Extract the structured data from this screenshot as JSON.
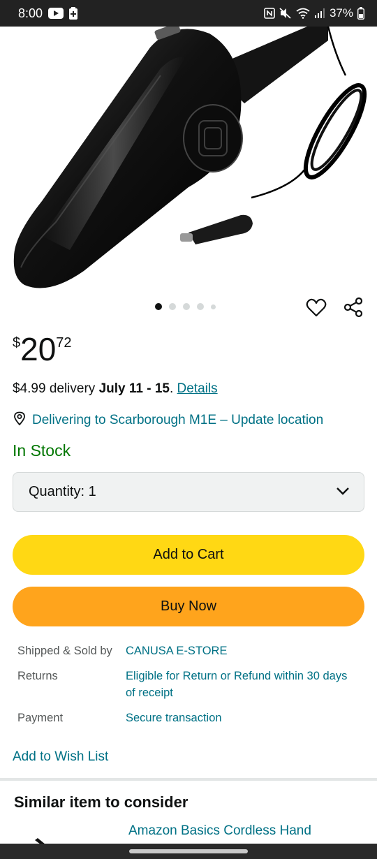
{
  "status_bar": {
    "time": "8:00",
    "battery": "37%",
    "icons": [
      "youtube-icon",
      "battery-saver-icon",
      "nfc-icon",
      "mute-icon",
      "wifi-icon",
      "signal-icon",
      "battery-icon"
    ]
  },
  "product": {
    "image_alt": "car-vacuum-image",
    "carousel": {
      "count": 5,
      "active_index": 0
    },
    "price": {
      "symbol": "$",
      "whole": "20",
      "fraction": "72"
    },
    "delivery": {
      "prefix": "$4.99 delivery ",
      "date": "July 11 - 15",
      "suffix": ". ",
      "details_link": "Details"
    },
    "location": "Delivering to Scarborough M1E – Update location",
    "stock": "In Stock",
    "quantity_label": "Quantity:",
    "quantity_value": "1",
    "add_to_cart": "Add to Cart",
    "buy_now": "Buy Now"
  },
  "seller_info": [
    {
      "label": "Shipped & Sold by",
      "value": "CANUSA E-STORE"
    },
    {
      "label": "Returns",
      "value": "Eligible for Return or Refund within 30 days of receipt"
    },
    {
      "label": "Payment",
      "value": "Secure transaction"
    }
  ],
  "wishlist_link": "Add to Wish List",
  "similar": {
    "title": "Similar item to consider",
    "item_name": "Amazon Basics Cordless Hand"
  },
  "colors": {
    "add_to_cart": "#ffd814",
    "buy_now": "#ffa41c",
    "link": "#007185",
    "in_stock": "#007600"
  }
}
